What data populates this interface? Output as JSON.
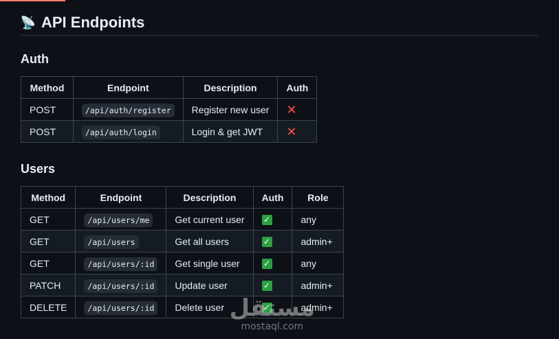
{
  "header": {
    "icon": "📡",
    "title": "API Endpoints"
  },
  "auth_section": {
    "title": "Auth",
    "columns": [
      "Method",
      "Endpoint",
      "Description",
      "Auth"
    ],
    "rows": [
      {
        "method": "POST",
        "endpoint": "/api/auth/register",
        "description": "Register new user",
        "auth": "❌"
      },
      {
        "method": "POST",
        "endpoint": "/api/auth/login",
        "description": "Login & get JWT",
        "auth": "❌"
      }
    ]
  },
  "users_section": {
    "title": "Users",
    "columns": [
      "Method",
      "Endpoint",
      "Description",
      "Auth",
      "Role"
    ],
    "rows": [
      {
        "method": "GET",
        "endpoint": "/api/users/me",
        "description": "Get current user",
        "auth": "✅",
        "role": "any"
      },
      {
        "method": "GET",
        "endpoint": "/api/users",
        "description": "Get all users",
        "auth": "✅",
        "role": "admin+"
      },
      {
        "method": "GET",
        "endpoint": "/api/users/:id",
        "description": "Get single user",
        "auth": "✅",
        "role": "any"
      },
      {
        "method": "PATCH",
        "endpoint": "/api/users/:id",
        "description": "Update user",
        "auth": "✅",
        "role": "admin+"
      },
      {
        "method": "DELETE",
        "endpoint": "/api/users/:id",
        "description": "Delete user",
        "auth": "✅",
        "role": "admin+"
      }
    ]
  },
  "watermark": {
    "arabic": "مستقل",
    "latin": "mostaql.com"
  },
  "colors": {
    "background": "#0d1117",
    "border": "#3d444d",
    "cross": "#f85149",
    "check": "#2ea043"
  }
}
